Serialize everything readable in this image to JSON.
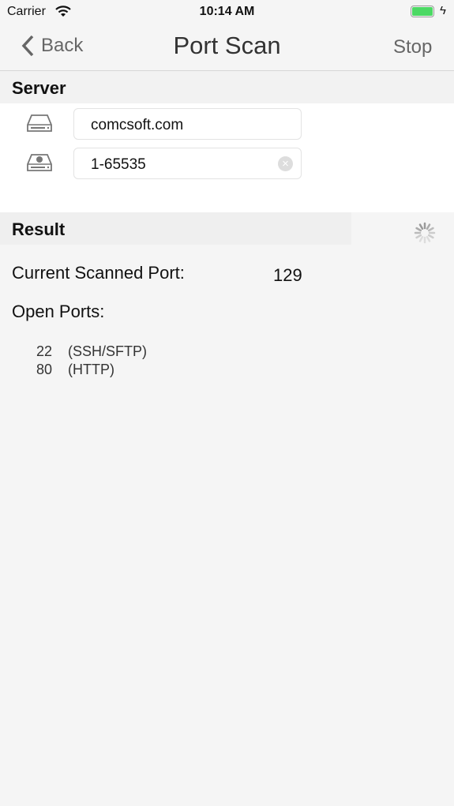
{
  "status_bar": {
    "carrier": "Carrier",
    "time": "10:14 AM",
    "battery_color": "#4cd964"
  },
  "nav": {
    "back": "Back",
    "title": "Port Scan",
    "stop": "Stop"
  },
  "server": {
    "header": "Server",
    "host": "comcsoft.com",
    "ports": "1-65535"
  },
  "result": {
    "header": "Result",
    "current_label": "Current Scanned Port:",
    "current_value": "129",
    "open_label": "Open Ports:",
    "open_ports": [
      {
        "port": "22",
        "service": "(SSH/SFTP)"
      },
      {
        "port": "80",
        "service": "(HTTP)"
      }
    ]
  }
}
